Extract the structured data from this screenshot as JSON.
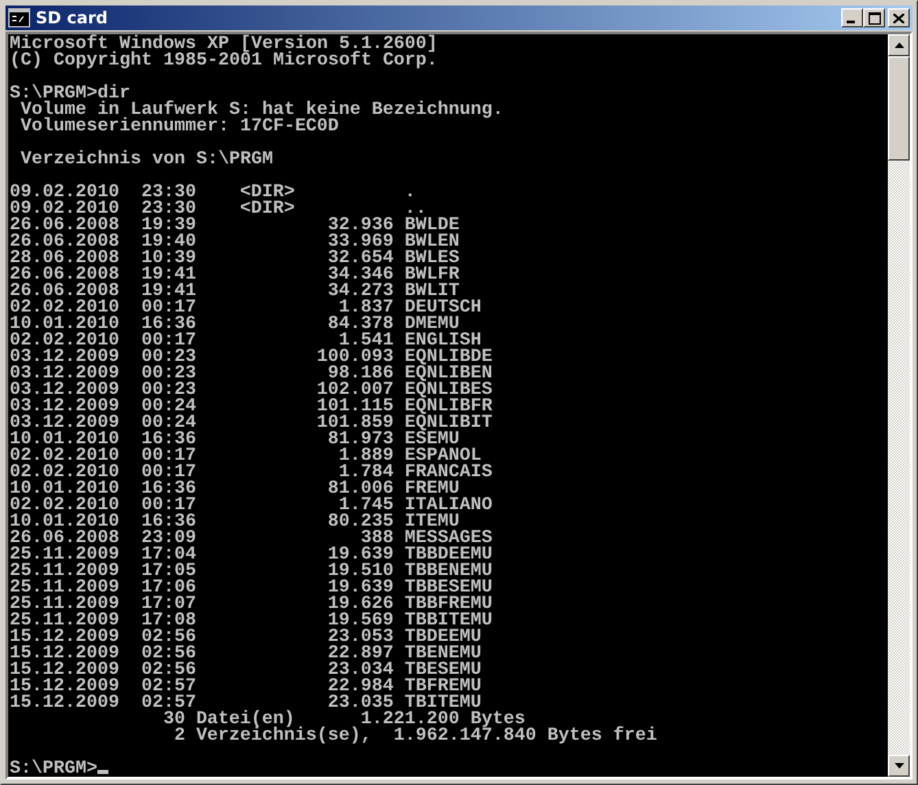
{
  "window": {
    "title": "SD card"
  },
  "console": {
    "header": [
      "Microsoft Windows XP [Version 5.1.2600]",
      "(C) Copyright 1985-2001 Microsoft Corp."
    ],
    "command": {
      "prompt": "S:\\PRGM>",
      "input": "dir"
    },
    "volume": [
      "Volume in Laufwerk S: hat keine Bezeichnung.",
      "Volumeseriennummer: 17CF-EC0D"
    ],
    "directory": "Verzeichnis von S:\\PRGM",
    "entries": [
      {
        "kind": "dir",
        "date": "09.02.2010",
        "time": "23:30",
        "size": "<DIR>",
        "name": "."
      },
      {
        "kind": "dir",
        "date": "09.02.2010",
        "time": "23:30",
        "size": "<DIR>",
        "name": ".."
      },
      {
        "kind": "file",
        "date": "26.06.2008",
        "time": "19:39",
        "size": "32.936",
        "name": "BWLDE"
      },
      {
        "kind": "file",
        "date": "26.06.2008",
        "time": "19:40",
        "size": "33.969",
        "name": "BWLEN"
      },
      {
        "kind": "file",
        "date": "28.06.2008",
        "time": "10:39",
        "size": "32.654",
        "name": "BWLES"
      },
      {
        "kind": "file",
        "date": "26.06.2008",
        "time": "19:41",
        "size": "34.346",
        "name": "BWLFR"
      },
      {
        "kind": "file",
        "date": "26.06.2008",
        "time": "19:41",
        "size": "34.273",
        "name": "BWLIT"
      },
      {
        "kind": "file",
        "date": "02.02.2010",
        "time": "00:17",
        "size": "1.837",
        "name": "DEUTSCH"
      },
      {
        "kind": "file",
        "date": "10.01.2010",
        "time": "16:36",
        "size": "84.378",
        "name": "DMEMU"
      },
      {
        "kind": "file",
        "date": "02.02.2010",
        "time": "00:17",
        "size": "1.541",
        "name": "ENGLISH"
      },
      {
        "kind": "file",
        "date": "03.12.2009",
        "time": "00:23",
        "size": "100.093",
        "name": "EQNLIBDE"
      },
      {
        "kind": "file",
        "date": "03.12.2009",
        "time": "00:23",
        "size": "98.186",
        "name": "EQNLIBEN"
      },
      {
        "kind": "file",
        "date": "03.12.2009",
        "time": "00:23",
        "size": "102.007",
        "name": "EQNLIBES"
      },
      {
        "kind": "file",
        "date": "03.12.2009",
        "time": "00:24",
        "size": "101.115",
        "name": "EQNLIBFR"
      },
      {
        "kind": "file",
        "date": "03.12.2009",
        "time": "00:24",
        "size": "101.859",
        "name": "EQNLIBIT"
      },
      {
        "kind": "file",
        "date": "10.01.2010",
        "time": "16:36",
        "size": "81.973",
        "name": "ESEMU"
      },
      {
        "kind": "file",
        "date": "02.02.2010",
        "time": "00:17",
        "size": "1.889",
        "name": "ESPANOL"
      },
      {
        "kind": "file",
        "date": "02.02.2010",
        "time": "00:17",
        "size": "1.784",
        "name": "FRANCAIS"
      },
      {
        "kind": "file",
        "date": "10.01.2010",
        "time": "16:36",
        "size": "81.006",
        "name": "FREMU"
      },
      {
        "kind": "file",
        "date": "02.02.2010",
        "time": "00:17",
        "size": "1.745",
        "name": "ITALIANO"
      },
      {
        "kind": "file",
        "date": "10.01.2010",
        "time": "16:36",
        "size": "80.235",
        "name": "ITEMU"
      },
      {
        "kind": "file",
        "date": "26.06.2008",
        "time": "23:09",
        "size": "388",
        "name": "MESSAGES"
      },
      {
        "kind": "file",
        "date": "25.11.2009",
        "time": "17:04",
        "size": "19.639",
        "name": "TBBDEEMU"
      },
      {
        "kind": "file",
        "date": "25.11.2009",
        "time": "17:05",
        "size": "19.510",
        "name": "TBBENEMU"
      },
      {
        "kind": "file",
        "date": "25.11.2009",
        "time": "17:06",
        "size": "19.639",
        "name": "TBBESEMU"
      },
      {
        "kind": "file",
        "date": "25.11.2009",
        "time": "17:07",
        "size": "19.626",
        "name": "TBBFREMU"
      },
      {
        "kind": "file",
        "date": "25.11.2009",
        "time": "17:08",
        "size": "19.569",
        "name": "TBBITEMU"
      },
      {
        "kind": "file",
        "date": "15.12.2009",
        "time": "02:56",
        "size": "23.053",
        "name": "TBDEEMU"
      },
      {
        "kind": "file",
        "date": "15.12.2009",
        "time": "02:56",
        "size": "22.897",
        "name": "TBENEMU"
      },
      {
        "kind": "file",
        "date": "15.12.2009",
        "time": "02:56",
        "size": "23.034",
        "name": "TBESEMU"
      },
      {
        "kind": "file",
        "date": "15.12.2009",
        "time": "02:57",
        "size": "22.984",
        "name": "TBFREMU"
      },
      {
        "kind": "file",
        "date": "15.12.2009",
        "time": "02:57",
        "size": "23.035",
        "name": "TBITEMU"
      }
    ],
    "summary": [
      {
        "count": "30",
        "label": "Datei(en)",
        "bytes": "1.221.200 Bytes"
      },
      {
        "count": "2",
        "label": "Verzeichnis(se),",
        "bytes": "1.962.147.840 Bytes frei"
      }
    ],
    "prompt": "S:\\PRGM>"
  }
}
